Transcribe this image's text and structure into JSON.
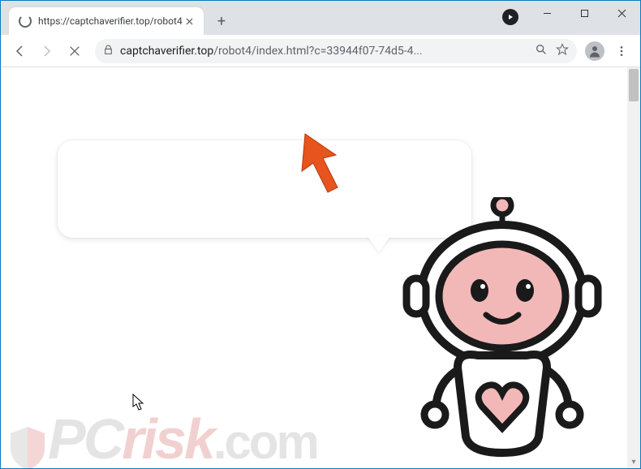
{
  "window": {
    "tab_title": "https://captchaverifier.top/robot4",
    "controls": {
      "minimize": "minimize",
      "maximize": "maximize",
      "close": "close"
    }
  },
  "toolbar": {
    "back": "back",
    "forward": "forward",
    "stop": "stop",
    "url_domain": "captchaverifier.top",
    "url_path": "/robot4/index.html?c=33944f07-74d5-4...",
    "search_icon": "search",
    "star_icon": "star",
    "profile": "profile",
    "menu": "menu"
  },
  "page": {
    "speech_text": "",
    "robot_alt": "robot-character"
  },
  "watermark": {
    "p": "P",
    "c": "C",
    "risk": "risk",
    "com": ".com"
  },
  "colors": {
    "accent_orange": "#e8541e",
    "browser_frame": "#dee1e6",
    "robot_outline": "#1a1a1a",
    "robot_pink": "#f2b8b8"
  }
}
